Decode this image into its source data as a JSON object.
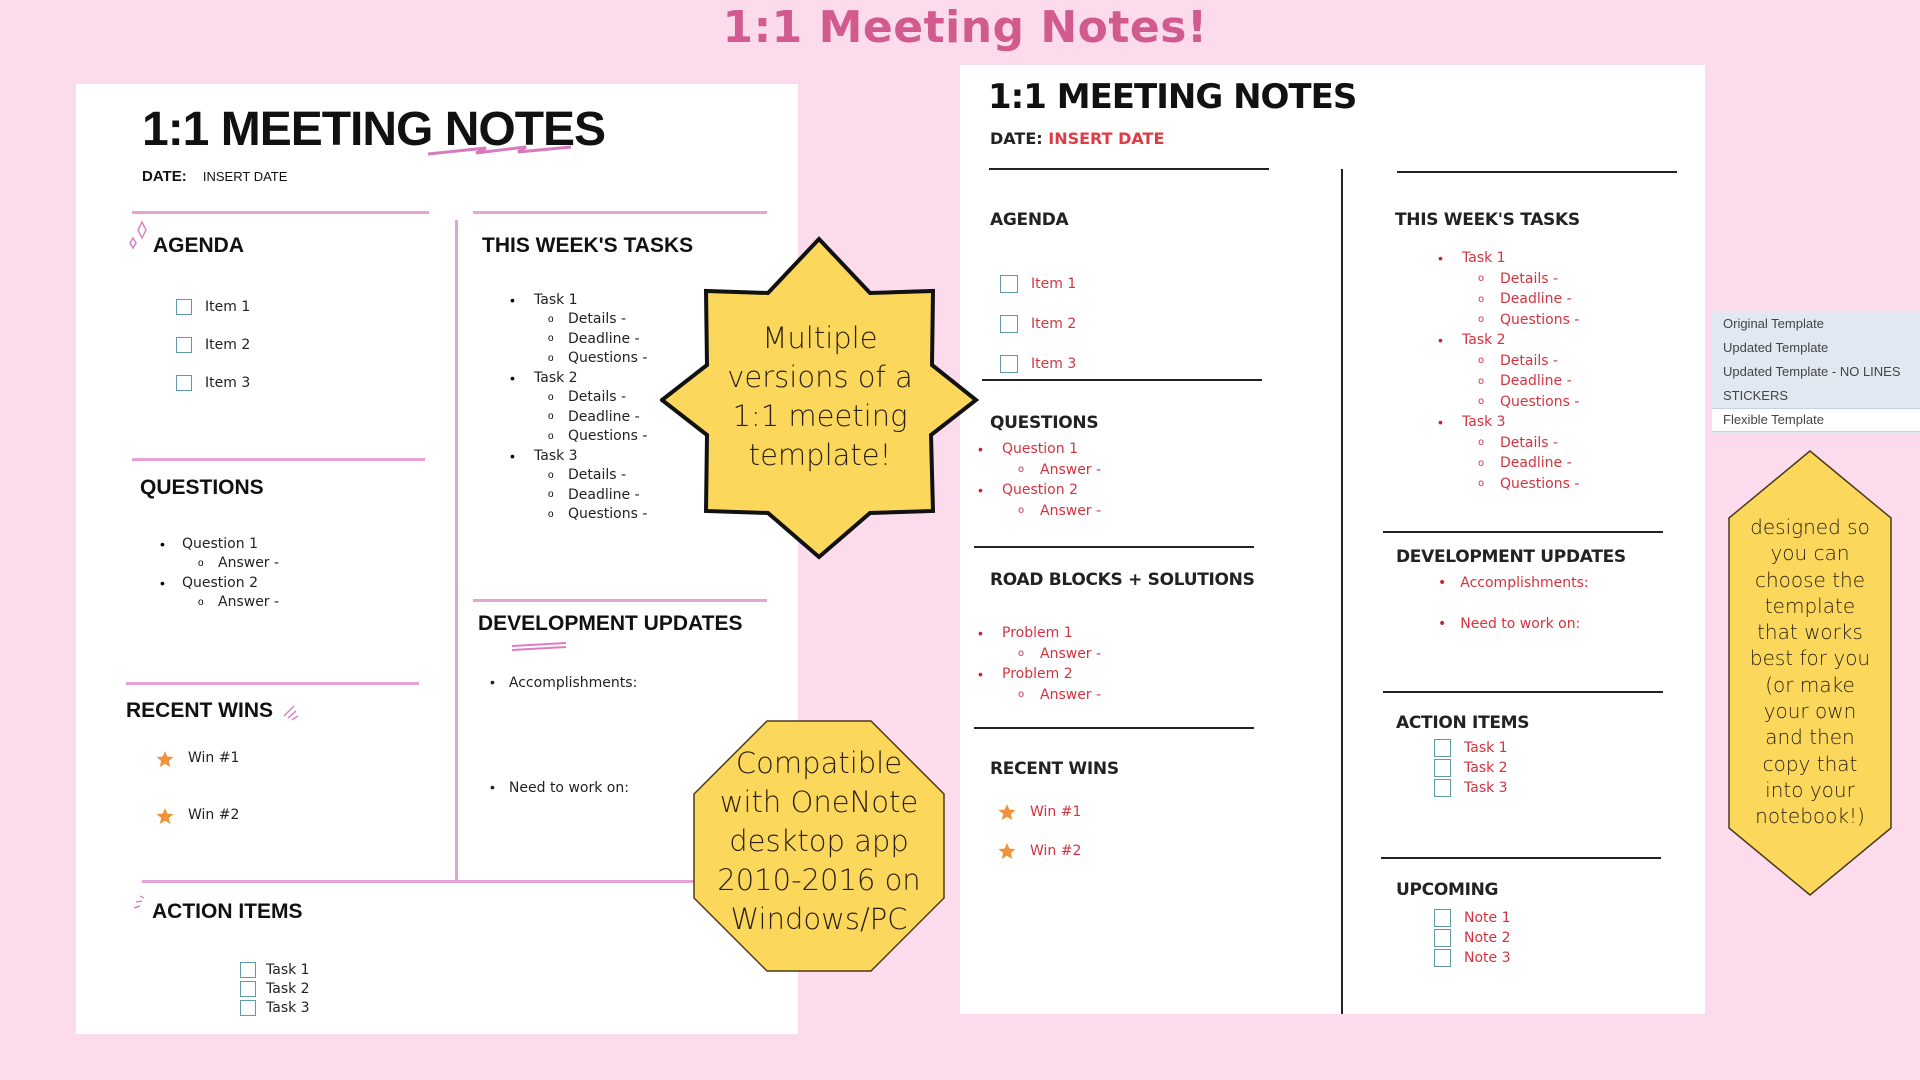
{
  "banner": {
    "title": "1:1 Meeting Notes!"
  },
  "callouts": {
    "star": [
      "Multiple",
      "versions of a",
      "1:1 meeting",
      "template!"
    ],
    "octagon": [
      "Compatible",
      "with OneNote",
      "desktop app",
      "2010-2016 on",
      "Windows/PC"
    ],
    "hexagon": [
      "designed so",
      "you can",
      "choose the",
      "template",
      "that works",
      "best for you",
      "(or make",
      "your own",
      "and then",
      "copy that",
      "into your",
      "notebook!)"
    ]
  },
  "colors": {
    "banner": "#d15a8f",
    "callout": "#fbd85c",
    "accent_pink": "#e7a3d3",
    "accent_red": "#d3333f",
    "star": "#f0923a"
  },
  "left_page": {
    "title": "1:1 MEETING NOTES",
    "date_label": "DATE:",
    "date_value": "INSERT DATE",
    "agenda": {
      "heading": "AGENDA",
      "items": [
        "Item 1",
        "Item 2",
        "Item 3"
      ]
    },
    "tasks": {
      "heading": "THIS WEEK'S TASKS",
      "items": [
        {
          "label": "Task 1",
          "sub": [
            "Details -",
            "Deadline -",
            "Questions -"
          ]
        },
        {
          "label": "Task 2",
          "sub": [
            "Details -",
            "Deadline -",
            "Questions -"
          ]
        },
        {
          "label": "Task 3",
          "sub": [
            "Details -",
            "Deadline -",
            "Questions -"
          ]
        }
      ]
    },
    "questions": {
      "heading": "QUESTIONS",
      "items": [
        {
          "label": "Question 1",
          "sub": "Answer -"
        },
        {
          "label": "Question 2",
          "sub": "Answer -"
        }
      ]
    },
    "wins": {
      "heading": "RECENT WINS",
      "items": [
        "Win #1",
        "Win #2"
      ]
    },
    "dev": {
      "heading": "DEVELOPMENT UPDATES",
      "items": [
        "Accomplishments:",
        "Need to work on:"
      ]
    },
    "actions": {
      "heading": "ACTION ITEMS",
      "items": [
        "Task 1",
        "Task 2",
        "Task 3"
      ]
    }
  },
  "right_page": {
    "title": "1:1 MEETING NOTES",
    "date_label": "DATE:",
    "date_value": "INSERT DATE",
    "agenda": {
      "heading": "AGENDA",
      "items": [
        "Item 1",
        "Item 2",
        "Item 3"
      ]
    },
    "questions": {
      "heading": "QUESTIONS",
      "items": [
        {
          "label": "Question 1",
          "sub": "Answer -"
        },
        {
          "label": "Question 2",
          "sub": "Answer -"
        }
      ]
    },
    "roadblocks": {
      "heading": "ROAD BLOCKS + SOLUTIONS",
      "items": [
        {
          "label": "Problem 1",
          "sub": "Answer -"
        },
        {
          "label": "Problem 2",
          "sub": "Answer -"
        }
      ]
    },
    "wins": {
      "heading": "RECENT WINS",
      "items": [
        "Win #1",
        "Win #2"
      ]
    },
    "tasks": {
      "heading": "THIS WEEK'S TASKS",
      "items": [
        {
          "label": "Task 1",
          "sub": [
            "Details -",
            "Deadline -",
            "Questions -"
          ]
        },
        {
          "label": "Task 2",
          "sub": [
            "Details -",
            "Deadline -",
            "Questions -"
          ]
        },
        {
          "label": "Task 3",
          "sub": [
            "Details -",
            "Deadline -",
            "Questions -"
          ]
        }
      ]
    },
    "dev": {
      "heading": "DEVELOPMENT UPDATES",
      "items": [
        "Accomplishments:",
        "Need to work on:"
      ]
    },
    "actions": {
      "heading": "ACTION ITEMS",
      "items": [
        "Task 1",
        "Task 2",
        "Task 3"
      ]
    },
    "upcoming": {
      "heading": "UPCOMING",
      "items": [
        "Note 1",
        "Note 2",
        "Note 3"
      ]
    }
  },
  "section_tabs": {
    "items": [
      "Original Template",
      "Updated Template",
      "Updated Template - NO LINES",
      "STICKERS",
      "Flexible Template"
    ],
    "active": "Flexible Template"
  }
}
